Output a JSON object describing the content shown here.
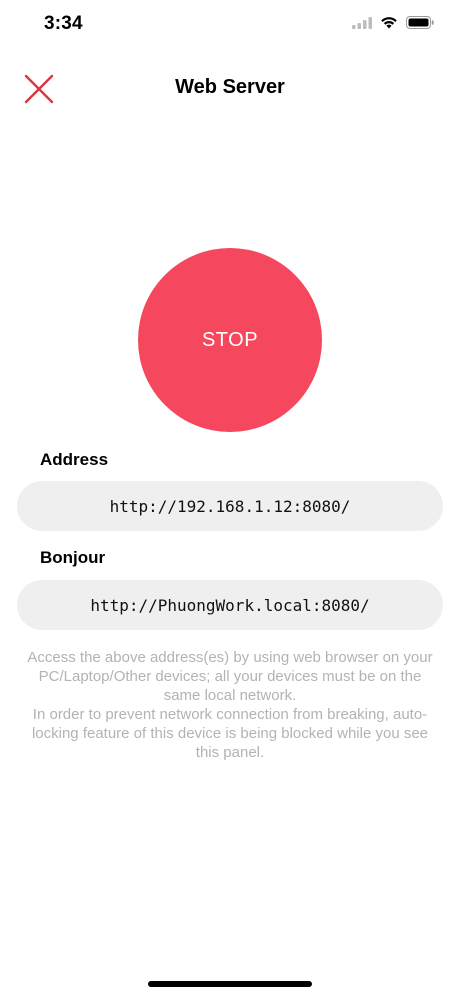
{
  "status_bar": {
    "time": "3:34",
    "icons": [
      "signal-icon",
      "wifi-icon",
      "battery-icon"
    ]
  },
  "nav": {
    "title": "Web Server",
    "close_icon": "close-icon"
  },
  "server_button": {
    "label": "STOP",
    "color": "#f5475d"
  },
  "address": {
    "label": "Address",
    "value": "http://192.168.1.12:8080/"
  },
  "bonjour": {
    "label": "Bonjour",
    "value": "http://PhuongWork.local:8080/"
  },
  "info": {
    "line1": "Access the above address(es) by using web browser on your PC/Laptop/Other devices; all your devices must be on the same local network.",
    "line2": "In order to prevent network connection from breaking, auto-locking feature of this device is being blocked while you see this panel."
  },
  "colors": {
    "accent_red": "#d9363e",
    "stop_red": "#f5475d",
    "pill_bg": "#efefef",
    "info_text": "#b3b3b3"
  }
}
